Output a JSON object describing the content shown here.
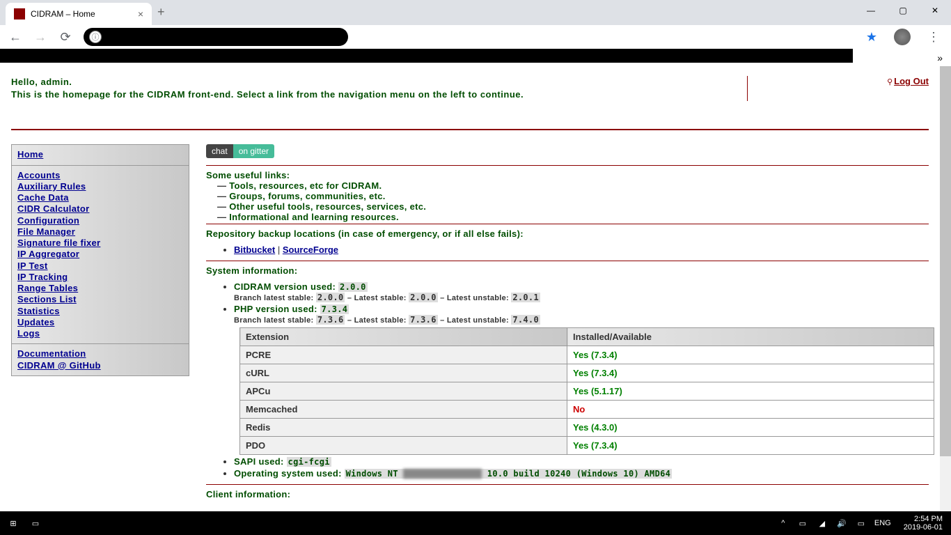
{
  "browser": {
    "tab_title": "CIDRAM – Home",
    "favicon_text": "cidr am"
  },
  "window_controls": {
    "min": "—",
    "max": "▢",
    "close": "✕"
  },
  "nav": {
    "back": "←",
    "forward": "→",
    "reload": "⟳",
    "info": "ⓘ",
    "star": "★",
    "menu": "⋮",
    "overflow": "»"
  },
  "header": {
    "greeting": "Hello, admin.",
    "subtext": "This is the homepage for the CIDRAM front-end. Select a link from the navigation menu on the left to continue.",
    "logout": "Log Out",
    "key": "⚲"
  },
  "sidebar": {
    "group1": [
      "Home"
    ],
    "group2": [
      "Accounts",
      "Auxiliary Rules",
      "Cache Data",
      "CIDR Calculator",
      "Configuration",
      "File Manager",
      "Signature file fixer",
      "IP Aggregator",
      "IP Test",
      "IP Tracking",
      "Range Tables",
      "Sections List",
      "Statistics",
      "Updates",
      "Logs"
    ],
    "group3": [
      "Documentation",
      "CIDRAM @ GitHub"
    ]
  },
  "chat": {
    "left": "chat",
    "right": "on gitter"
  },
  "sections": {
    "useful_title": "Some useful links:",
    "useful_items": [
      "Tools, resources, etc for CIDRAM.",
      "Groups, forums, communities, etc.",
      "Other useful tools, resources, services, etc.",
      "Informational and learning resources."
    ],
    "repo_title": "Repository backup locations (in case of emergency, or if all else fails):",
    "repo_links": {
      "bitbucket": "Bitbucket",
      "sep": " | ",
      "sourceforge": "SourceForge"
    },
    "sysinfo_title": "System information:",
    "cidram_line": "CIDRAM version used: ",
    "cidram_ver": "2.0.0",
    "branch_prefix": "Branch latest stable: ",
    "latest_stable": " – Latest stable: ",
    "latest_unstable": " – Latest unstable: ",
    "cidram_branch": "2.0.0",
    "cidram_stable": "2.0.0",
    "cidram_unstable": "2.0.1",
    "php_line": "PHP version used: ",
    "php_ver": "7.3.4",
    "php_branch": "7.3.6",
    "php_stable": "7.3.6",
    "php_unstable": "7.4.0",
    "sapi_line": "SAPI used: ",
    "sapi_val": "cgi-fcgi",
    "os_line": "Operating system used: ",
    "os_prefix": "Windows NT ",
    "os_redacted": "XXXXXXXXXXXXXXX",
    "os_suffix": " 10.0 build 10240 (Windows 10) AMD64",
    "client_title": "Client information:"
  },
  "ext_table": {
    "headers": [
      "Extension",
      "Installed/Available"
    ],
    "rows": [
      {
        "name": "PCRE",
        "status": "Yes (7.3.4)",
        "ok": true
      },
      {
        "name": "cURL",
        "status": "Yes (7.3.4)",
        "ok": true
      },
      {
        "name": "APCu",
        "status": "Yes (5.1.17)",
        "ok": true
      },
      {
        "name": "Memcached",
        "status": "No",
        "ok": false
      },
      {
        "name": "Redis",
        "status": "Yes (4.3.0)",
        "ok": true
      },
      {
        "name": "PDO",
        "status": "Yes (7.3.4)",
        "ok": true
      }
    ]
  },
  "taskbar": {
    "lang": "ENG",
    "time": "2:54 PM",
    "date": "2019-06-01"
  }
}
